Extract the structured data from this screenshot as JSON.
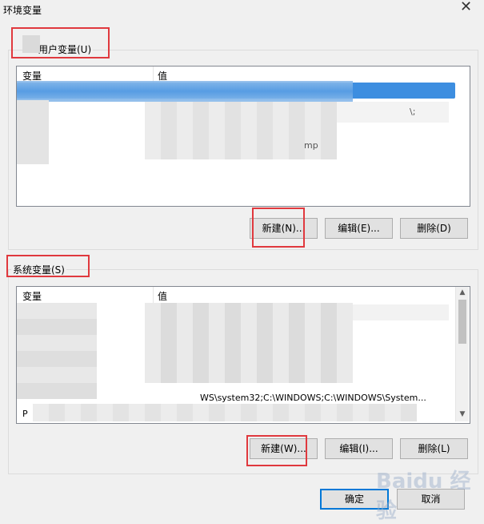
{
  "window": {
    "title": "环境变量",
    "close_glyph": "✕"
  },
  "user_vars": {
    "group_label": "用户变量(U)",
    "header_name": "变量",
    "header_value": "值",
    "visible_fragments": [
      "\\;",
      "mp"
    ],
    "buttons": {
      "new": "新建(N)...",
      "edit": "编辑(E)...",
      "delete": "删除(D)"
    }
  },
  "system_vars": {
    "group_label": "系统变量(S)",
    "header_name": "变量",
    "header_value": "值",
    "visible_fragments": [
      "WS\\system32;C:\\WINDOWS;C:\\WINDOWS\\System...",
      "P"
    ],
    "buttons": {
      "new": "新建(W)...",
      "edit": "编辑(I)...",
      "delete": "删除(L)"
    }
  },
  "dialog_buttons": {
    "ok": "确定",
    "cancel": "取消"
  },
  "watermark": "Baidu 经验",
  "colors": {
    "selection": "#3d8ee0",
    "highlight_box": "#e0393e",
    "default_button_border": "#0078d7"
  }
}
